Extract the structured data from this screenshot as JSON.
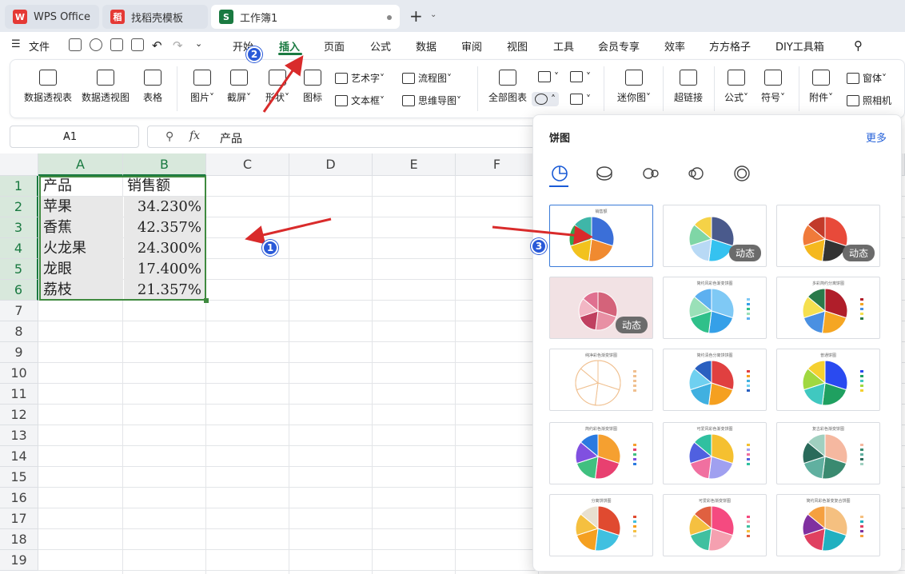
{
  "tabs": [
    {
      "label": "WPS Office",
      "logo": "W",
      "color": "#e53935"
    },
    {
      "label": "找稻壳模板",
      "logo": "稻",
      "color": "#e53935"
    },
    {
      "label": "工作簿1",
      "logo": "S",
      "color": "#1a7a41"
    }
  ],
  "menu": {
    "file": "文件",
    "items": [
      "开始",
      "插入",
      "页面",
      "公式",
      "数据",
      "审阅",
      "视图",
      "工具",
      "会员专享",
      "效率",
      "方方格子",
      "DIY工具箱"
    ],
    "active": "插入"
  },
  "ribbon": {
    "pivot_table": "数据透视表",
    "pivot_chart": "数据透视图",
    "table": "表格",
    "picture": "图片",
    "screenshot": "截屏",
    "shape": "形状",
    "icon": "图标",
    "wordart": "艺术字",
    "textbox": "文本框",
    "flowchart": "流程图",
    "mindmap": "思维导图",
    "all_charts": "全部图表",
    "sparkline": "迷你图",
    "hyperlink": "超链接",
    "formula": "公式",
    "symbol": "符号",
    "attachment": "附件",
    "form": "窗体",
    "camera": "照相机"
  },
  "formula_bar": {
    "cell_ref": "A1",
    "fx": "fx",
    "value": "产品"
  },
  "columns": [
    "A",
    "B",
    "C",
    "D",
    "E",
    "F"
  ],
  "rows": [
    "1",
    "2",
    "3",
    "4",
    "5",
    "6",
    "7",
    "8",
    "9",
    "10",
    "11",
    "12",
    "13",
    "14",
    "15",
    "16",
    "17",
    "18",
    "19"
  ],
  "sheet": {
    "header": [
      "产品",
      "销售额"
    ],
    "data": [
      [
        "苹果",
        "34.230%"
      ],
      [
        "香蕉",
        "42.357%"
      ],
      [
        "火龙果",
        "24.300%"
      ],
      [
        "龙眼",
        "17.400%"
      ],
      [
        "荔枝",
        "21.357%"
      ]
    ]
  },
  "panel": {
    "title": "饼图",
    "more": "更多",
    "badge": "动态",
    "thumb_titles": [
      "销售额",
      "简约风彩色渐变饼图",
      "多彩简约分离饼图",
      "纯净彩色渐变饼图",
      "简约清色分离饼饼图",
      "普通饼图",
      "简约彩色渐变饼图",
      "可爱风彩色渐变饼图",
      "复古彩色渐变饼图",
      "分离饼饼图",
      "可爱彩色渐变饼图",
      "简约风彩色渐变复合饼图"
    ]
  },
  "markers": [
    "1",
    "2",
    "3"
  ],
  "colors": {
    "accent": "#1a7a41",
    "selection": "#3f8a3f",
    "arrow": "#d92b2b",
    "marker": "#2a5ad8"
  }
}
